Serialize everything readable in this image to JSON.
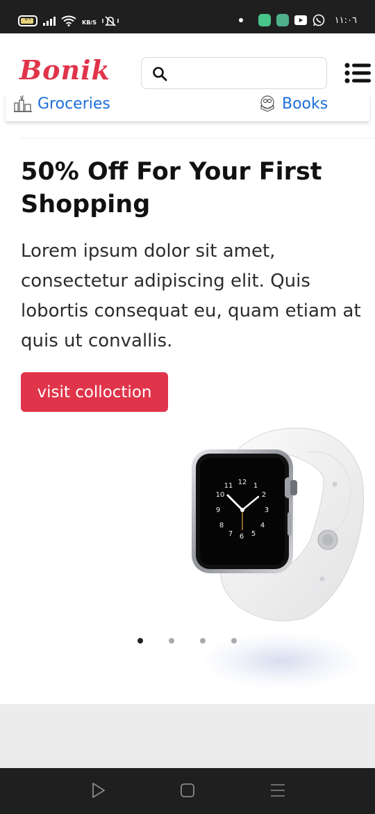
{
  "status_bar": {
    "battery_level": "٥٩",
    "net_speed": "KB/S",
    "time": "١١:٠٦",
    "icons": [
      "battery-icon",
      "signal-icon",
      "wifi-icon",
      "mute-icon",
      "phone-app-icon",
      "upload-app-icon",
      "youtube-icon",
      "whatsapp-icon"
    ]
  },
  "header": {
    "logo": "Bonik",
    "search_placeholder": "",
    "icons": [
      "search-icon",
      "menu-icon"
    ]
  },
  "categories": [
    {
      "label": "Groceries",
      "icon": "groceries-icon"
    },
    {
      "label": "Books",
      "icon": "books-icon"
    }
  ],
  "hero": {
    "title": "50% Off For Your First Shopping",
    "text": "Lorem ipsum dolor sit amet, consectetur adipiscing elit. Quis lobortis consequat eu, quam etiam at quis ut convallis.",
    "button_label": "visit colloction",
    "image": "smartwatch-image"
  },
  "carousel": {
    "slide_count": 4,
    "active_index": 0
  },
  "colors": {
    "brand": "#e0344a",
    "link": "#1c6ed8",
    "status_bar": "#1f1f1f"
  },
  "nav_bar": {
    "icons": [
      "back-triangle-icon",
      "home-square-icon",
      "recents-lines-icon"
    ]
  }
}
